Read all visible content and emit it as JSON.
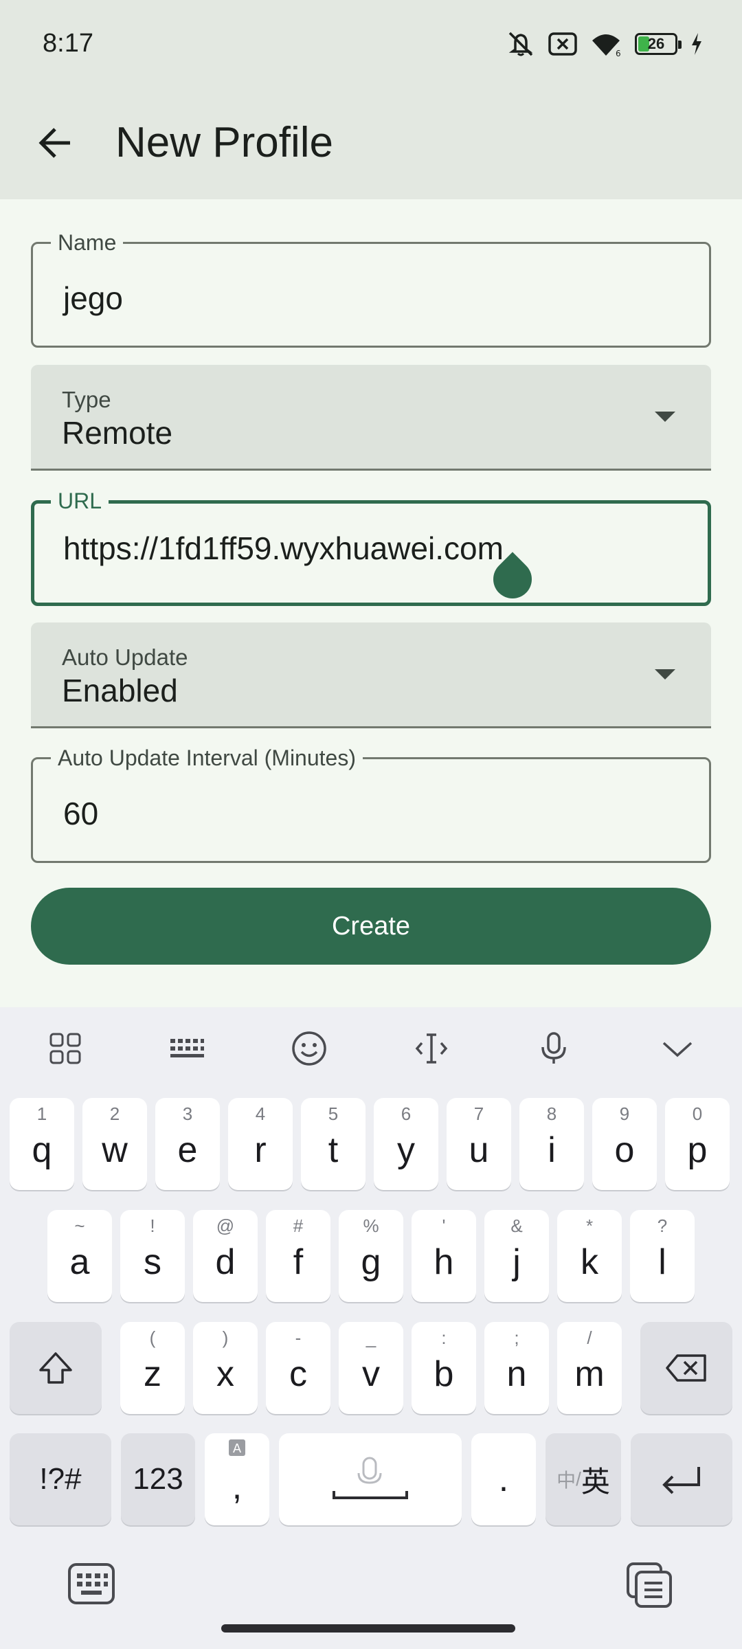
{
  "status_bar": {
    "time": "8:17",
    "battery": "26",
    "icons": [
      "mute-icon",
      "no-sim-icon",
      "wifi-icon",
      "battery-icon",
      "charging-icon"
    ]
  },
  "app_bar": {
    "title": "New Profile",
    "back_icon": "arrow-left-icon"
  },
  "form": {
    "name": {
      "label": "Name",
      "value": "jego"
    },
    "type": {
      "label": "Type",
      "value": "Remote"
    },
    "url": {
      "label": "URL",
      "value": "https://1fd1ff59.wyxhuawei.com"
    },
    "auto_update": {
      "label": "Auto Update",
      "value": "Enabled"
    },
    "interval": {
      "label": "Auto Update Interval (Minutes)",
      "value": "60"
    },
    "create_label": "Create"
  },
  "colors": {
    "accent": "#2f6b4e",
    "surface": "#f3f8f1",
    "header": "#e3e8e1"
  },
  "keyboard": {
    "toolbar": [
      "apps-grid-icon",
      "keyboard-layout-icon",
      "emoji-icon",
      "cursor-icon",
      "microphone-icon",
      "collapse-icon"
    ],
    "row1": [
      {
        "k": "q",
        "h": "1"
      },
      {
        "k": "w",
        "h": "2"
      },
      {
        "k": "e",
        "h": "3"
      },
      {
        "k": "r",
        "h": "4"
      },
      {
        "k": "t",
        "h": "5"
      },
      {
        "k": "y",
        "h": "6"
      },
      {
        "k": "u",
        "h": "7"
      },
      {
        "k": "i",
        "h": "8"
      },
      {
        "k": "o",
        "h": "9"
      },
      {
        "k": "p",
        "h": "0"
      }
    ],
    "row2": [
      {
        "k": "a",
        "h": "~"
      },
      {
        "k": "s",
        "h": "!"
      },
      {
        "k": "d",
        "h": "@"
      },
      {
        "k": "f",
        "h": "#"
      },
      {
        "k": "g",
        "h": "%"
      },
      {
        "k": "h",
        "h": "'"
      },
      {
        "k": "j",
        "h": "&"
      },
      {
        "k": "k",
        "h": "*"
      },
      {
        "k": "l",
        "h": "?"
      }
    ],
    "row3": [
      {
        "k": "z",
        "h": "("
      },
      {
        "k": "x",
        "h": ")"
      },
      {
        "k": "c",
        "h": "-"
      },
      {
        "k": "v",
        "h": "_"
      },
      {
        "k": "b",
        "h": ":"
      },
      {
        "k": "n",
        "h": ";"
      },
      {
        "k": "m",
        "h": "/"
      }
    ],
    "symbols_label": "!?#",
    "numbers_label": "123",
    "comma": ",",
    "period": ".",
    "lang_label_small": "中",
    "lang_label": "英"
  }
}
